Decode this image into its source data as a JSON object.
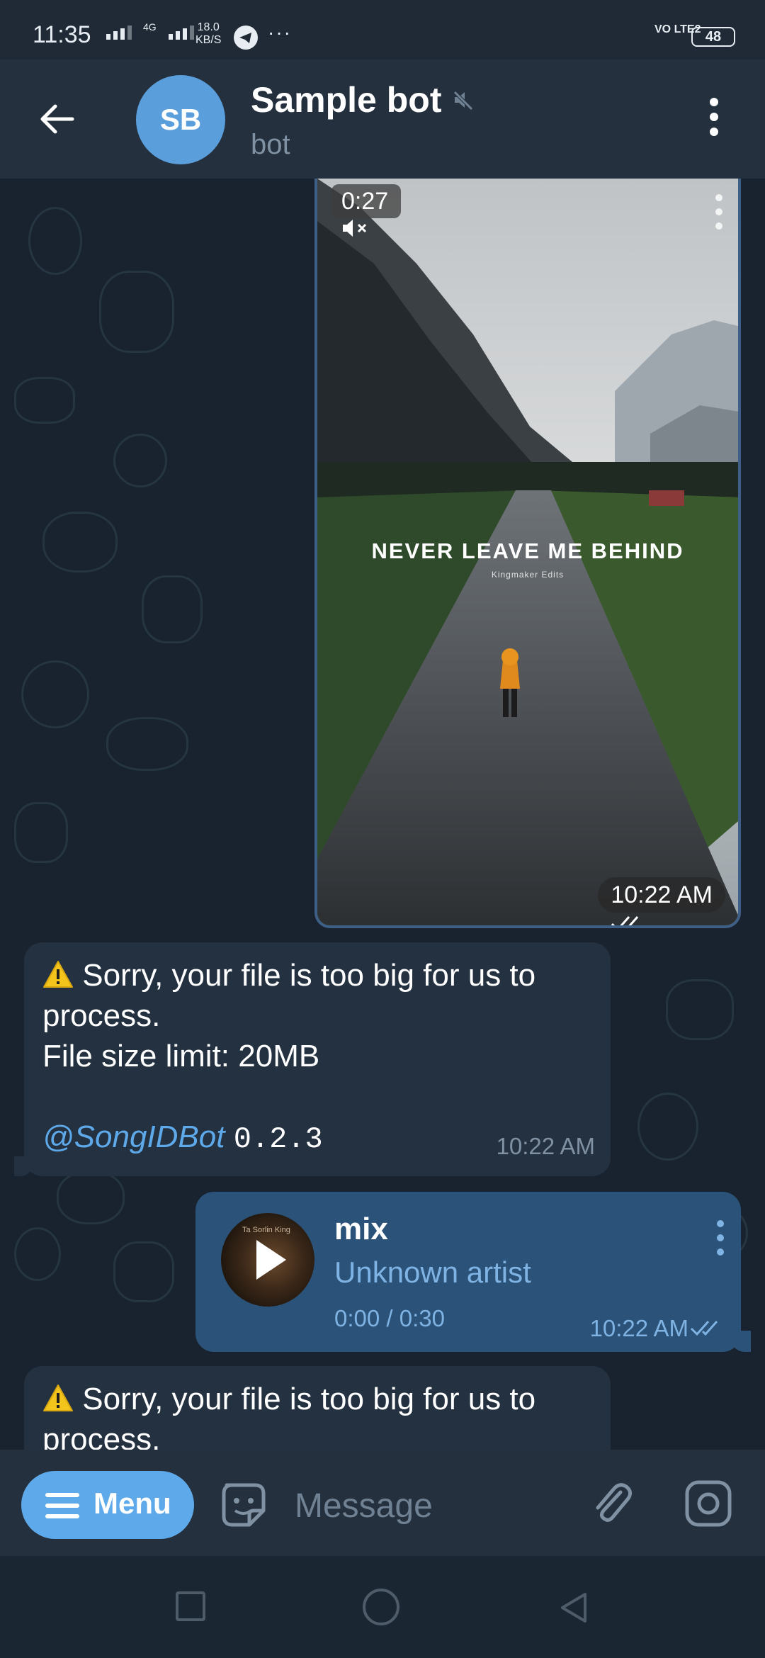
{
  "status_bar": {
    "time": "11:35",
    "network": "4G",
    "speed_value": "18.0",
    "speed_unit": "KB/S",
    "more": "···",
    "volte": "VO LTE2",
    "battery": "48"
  },
  "header": {
    "avatar_initials": "SB",
    "title": "Sample bot",
    "subtitle": "bot"
  },
  "video_message": {
    "duration": "0:27",
    "caption": "NEVER LEAVE ME BEHIND",
    "caption_sub": "Kingmaker Edits",
    "time": "10:22 AM"
  },
  "messages": [
    {
      "line1": "Sorry, your file is too big for us to",
      "line2": "process.",
      "line3": "File size limit: 20MB",
      "mention": "@SongIDBot",
      "version": "0.2.3",
      "time": "10:22 AM"
    },
    {
      "line1": "Sorry, your file is too big for us to",
      "line2": "process."
    }
  ],
  "audio_message": {
    "title": "mix",
    "artist": "Unknown artist",
    "progress": "0:00 / 0:30",
    "time": "10:22 AM",
    "cover_text": "Ta Sorlin King"
  },
  "input_bar": {
    "menu_label": "Menu",
    "placeholder": "Message"
  },
  "colors": {
    "accent": "#5ea9ea",
    "outgoing_bubble": "#2b5278",
    "incoming_bubble": "#243140",
    "header": "#24303d"
  }
}
